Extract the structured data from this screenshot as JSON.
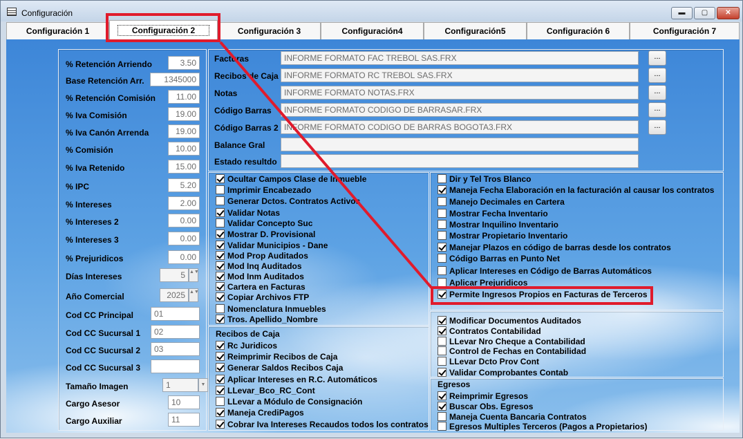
{
  "window": {
    "title": "Configuración",
    "minimize": "▬",
    "maximize": "▢",
    "close": "✕"
  },
  "tabs": [
    "Configuración 1",
    "Configuración 2",
    "Configuración 3",
    "Configuración4",
    "Configuración5",
    "Configuración 6",
    "Configuración 7"
  ],
  "left_fields": [
    {
      "label": "% Retención Arriendo",
      "value": "3.50"
    },
    {
      "label": "Base Retención Arr.",
      "value": "1345000"
    },
    {
      "label": "% Retención Comisión",
      "value": "11.00"
    },
    {
      "label": "% Iva Comisión",
      "value": "19.00"
    },
    {
      "label": "% Iva Canón Arrenda",
      "value": "19.00"
    },
    {
      "label": "% Comisión",
      "value": "10.00"
    },
    {
      "label": "% Iva Retenido",
      "value": "15.00"
    },
    {
      "label": "% IPC",
      "value": "5.20"
    },
    {
      "label": "% Intereses",
      "value": "2.00"
    },
    {
      "label": "% Intereses 2",
      "value": "0.00"
    },
    {
      "label": "% Intereses 3",
      "value": "0.00"
    },
    {
      "label": "% Prejuridicos",
      "value": "0.00"
    },
    {
      "label": "Días Intereses",
      "value": "5"
    },
    {
      "label": "Año Comercial",
      "value": "2025"
    },
    {
      "label": "Cod CC Principal",
      "value": "01"
    },
    {
      "label": "Cod CC Sucursal 1",
      "value": "02"
    },
    {
      "label": "Cod CC Sucursal 2",
      "value": "03"
    },
    {
      "label": "Cod CC Sucursal 3",
      "value": ""
    },
    {
      "label": "Tamaño Imagen",
      "value": "1"
    },
    {
      "label": "Cargo Asesor",
      "value": "10"
    },
    {
      "label": "Cargo Auxiliar",
      "value": "11"
    }
  ],
  "report_fields": [
    {
      "label": "Facturas",
      "value": "INFORME FORMATO FAC TREBOL SAS.FRX"
    },
    {
      "label": "Recibos de Caja",
      "value": "INFORME FORMATO RC TREBOL SAS.FRX"
    },
    {
      "label": "Notas",
      "value": "INFORME FORMATO NOTAS.FRX"
    },
    {
      "label": "Código Barras",
      "value": "INFORME FORMATO CODIGO DE BARRASAR.FRX"
    },
    {
      "label": "Código Barras 2",
      "value": "INFORME FORMATO CODIGO DE BARRAS BOGOTA3.FRX"
    },
    {
      "label": "Balance Gral",
      "value": ""
    },
    {
      "label": "Estado resultdo",
      "value": ""
    }
  ],
  "browse_label": "...",
  "checks_mid": [
    {
      "label": "Ocultar Campos Clase de Inmueble",
      "checked": true
    },
    {
      "label": "Imprimir Encabezado",
      "checked": false
    },
    {
      "label": "Generar Dctos. Contratos Activos",
      "checked": false
    },
    {
      "label": "Validar Notas",
      "checked": true
    },
    {
      "label": "Validar Concepto Suc",
      "checked": false
    },
    {
      "label": "Mostrar D. Provisional",
      "checked": true
    },
    {
      "label": "Validar Municipios - Dane",
      "checked": true
    },
    {
      "label": "Mod Prop Auditados",
      "checked": true
    },
    {
      "label": "Mod Inq Auditados",
      "checked": true
    },
    {
      "label": "Mod Inm Auditados",
      "checked": true
    },
    {
      "label": "Cartera en Facturas",
      "checked": true
    },
    {
      "label": "Copiar Archivos FTP",
      "checked": true
    },
    {
      "label": "Nomenclatura Inmuebles",
      "checked": false
    },
    {
      "label": "Tros. Apellido_Nombre",
      "checked": true
    }
  ],
  "recibos": {
    "title": "Recibos de Caja",
    "items": [
      {
        "label": "Rc Juridicos",
        "checked": true
      },
      {
        "label": "Reimprimir Recibos de Caja",
        "checked": true
      },
      {
        "label": "Generar Saldos Recibos Caja",
        "checked": true
      },
      {
        "label": "Aplicar Intereses en R.C. Automáticos",
        "checked": true
      },
      {
        "label": "LLevar_Bco_RC_Cont",
        "checked": true
      },
      {
        "label": "LLevar a Módulo de Consignación",
        "checked": false
      },
      {
        "label": "Maneja CrediPagos",
        "checked": true
      },
      {
        "label": "Cobrar Iva Intereses Recaudos todos los contratos",
        "checked": true
      }
    ]
  },
  "checks_right": [
    {
      "label": "Dir y Tel Tros Blanco",
      "checked": false
    },
    {
      "label": "Maneja Fecha Elaboración en la facturación al causar los contratos",
      "checked": true
    },
    {
      "label": "Manejo Decimales en Cartera",
      "checked": false
    },
    {
      "label": "Mostrar Fecha Inventario",
      "checked": false
    },
    {
      "label": "Mostrar Inquilino Inventario",
      "checked": false
    },
    {
      "label": "Mostrar Propietario Inventario",
      "checked": false
    },
    {
      "label": "Manejar Plazos en código de barras desde los contratos",
      "checked": true
    },
    {
      "label": "Código Barras en Punto Net",
      "checked": false
    },
    {
      "label": "Aplicar Intereses en Código de Barras Automáticos",
      "checked": false
    },
    {
      "label": "Aplicar Prejuridicos",
      "checked": false
    },
    {
      "label": "Permite Ingresos Propios en Facturas de Terceros",
      "checked": true
    }
  ],
  "checks_right2": [
    {
      "label": "Modificar Documentos Auditados",
      "checked": true
    },
    {
      "label": "Contratos Contabilidad",
      "checked": true
    },
    {
      "label": "LLevar Nro Cheque a Contabilidad",
      "checked": false
    },
    {
      "label": "Control de Fechas en Contabilidad",
      "checked": false
    },
    {
      "label": "LLevar Dcto Prov Cont",
      "checked": false
    },
    {
      "label": "Validar Comprobantes Contab",
      "checked": true
    }
  ],
  "egresos": {
    "title": "Egresos",
    "items": [
      {
        "label": "Reimprimir Egresos",
        "checked": true
      },
      {
        "label": "Buscar Obs. Egresos",
        "checked": true
      },
      {
        "label": "Maneja Cuenta Bancaria Contratos",
        "checked": false
      },
      {
        "label": "Egresos Multiples Terceros (Pagos a Propietarios)",
        "checked": false
      }
    ]
  },
  "colors": {
    "highlight": "#e01b2c",
    "sky": "#4f96de"
  }
}
